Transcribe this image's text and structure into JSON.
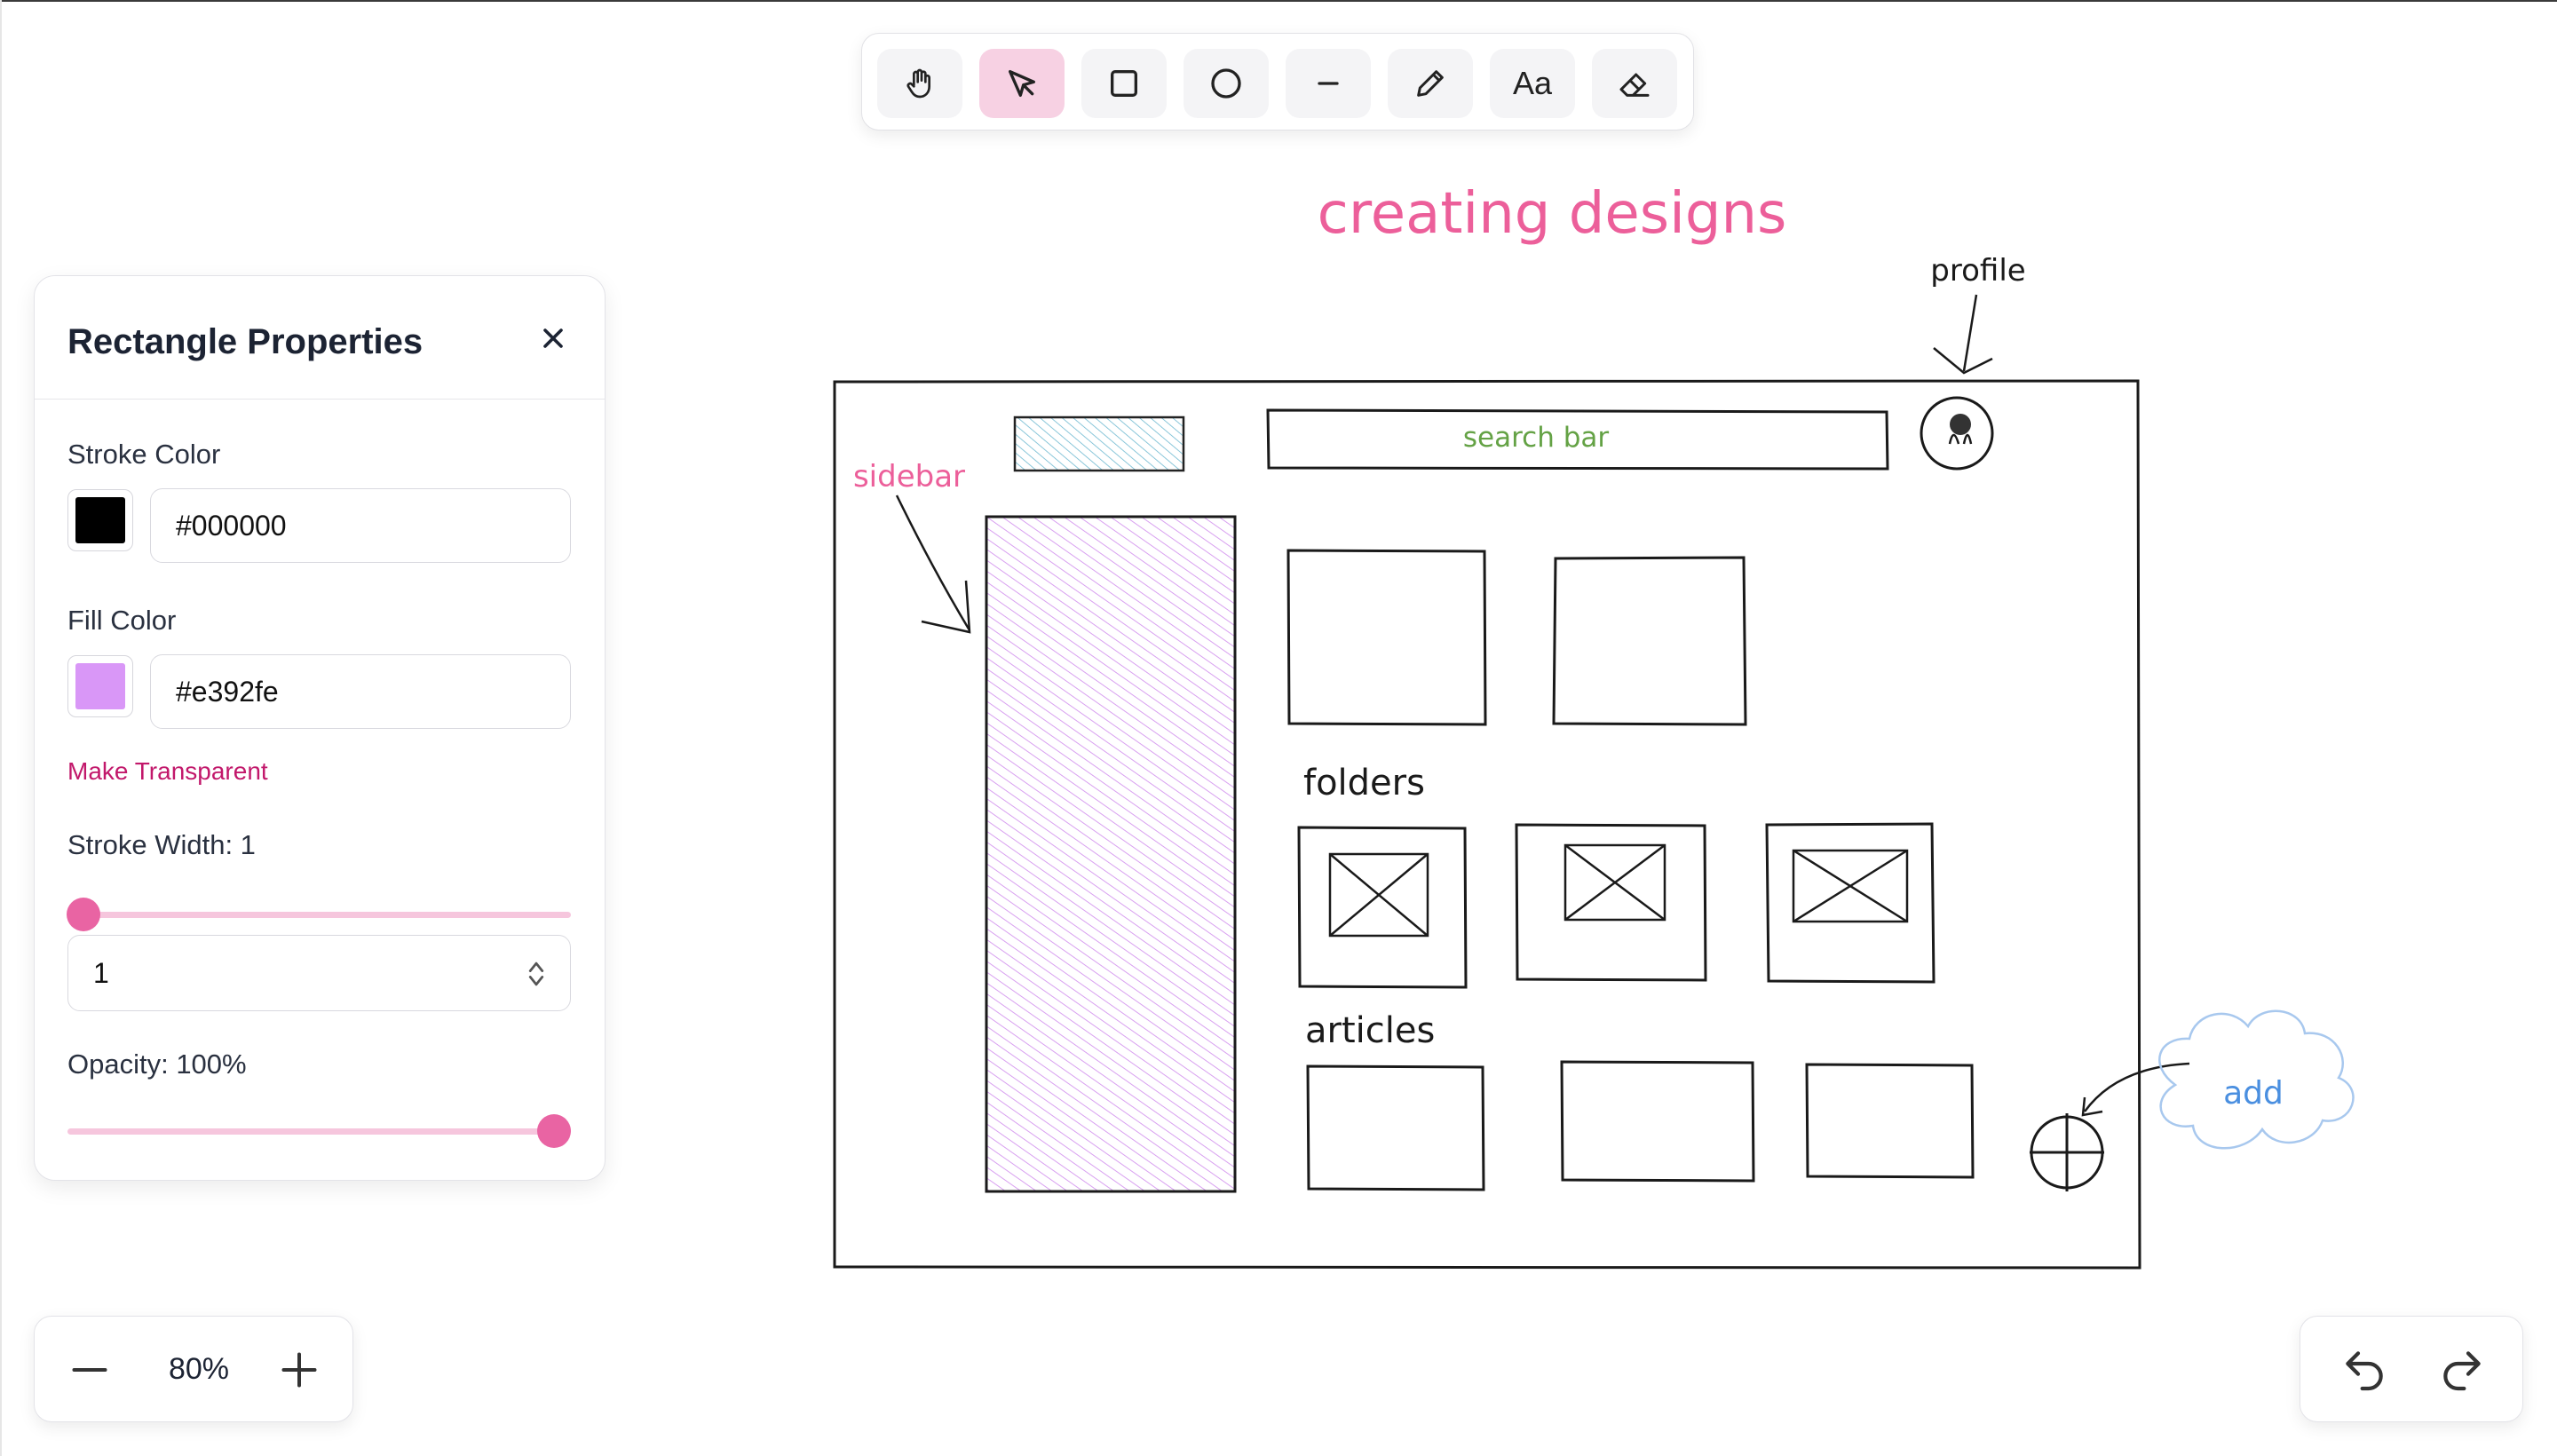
{
  "toolbar": {
    "tools": [
      {
        "name": "hand-icon",
        "label": "Hand"
      },
      {
        "name": "select-pointer-icon",
        "label": "Select",
        "active": true
      },
      {
        "name": "rectangle-icon",
        "label": "Rectangle"
      },
      {
        "name": "ellipse-icon",
        "label": "Ellipse"
      },
      {
        "name": "line-icon",
        "label": "Line"
      },
      {
        "name": "pencil-icon",
        "label": "Draw"
      },
      {
        "name": "text-icon",
        "label": "Aa"
      },
      {
        "name": "eraser-icon",
        "label": "Eraser"
      }
    ],
    "text_tool_label": "Aa",
    "active_color": "#f7d1e3"
  },
  "panel": {
    "title": "Rectangle Properties",
    "stroke_label": "Stroke Color",
    "stroke_value": "#000000",
    "fill_label": "Fill Color",
    "fill_value": "#e392fe",
    "transparent_link": "Make Transparent",
    "stroke_width_label": "Stroke Width: 1",
    "stroke_width_value": "1",
    "stroke_width_level": 0.0,
    "opacity_label": "Opacity: 100%",
    "opacity_level": 1.0,
    "accent": "#e964a3"
  },
  "canvas": {
    "title": "creating designs",
    "profile_label": "profile",
    "sidebar_label": "sidebar",
    "search_label": "search bar",
    "folders_label": "folders",
    "articles_label": "articles",
    "add_label": "add",
    "colors": {
      "title": "#ec5f9a",
      "sidebar_label": "#ec5f9a",
      "search_label": "#64a245",
      "add_label": "#4a8fe0",
      "sidebar_fill": "#e392fe",
      "header_fill": "#7cc6d4"
    }
  },
  "zoom": {
    "value": "80%"
  }
}
